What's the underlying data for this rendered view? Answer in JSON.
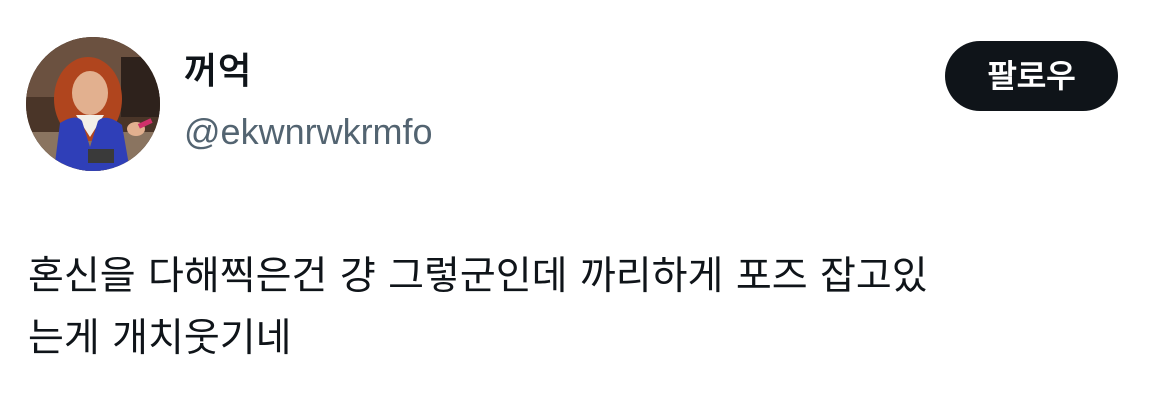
{
  "user": {
    "display_name": "꺼억",
    "handle": "@ekwnrwkrmfo",
    "avatar_icon": "profile-photo"
  },
  "follow_button": {
    "label": "팔로우"
  },
  "tweet": {
    "lines": [
      "혼신을 다해찍은건 걍 그렇군인데 까리하게 포즈 잡고있",
      "는게 개치웃기네"
    ]
  },
  "colors": {
    "primary_text": "#0f1419",
    "secondary_text": "#536471",
    "button_bg": "#0f1419",
    "button_text": "#ffffff",
    "background": "#ffffff"
  }
}
